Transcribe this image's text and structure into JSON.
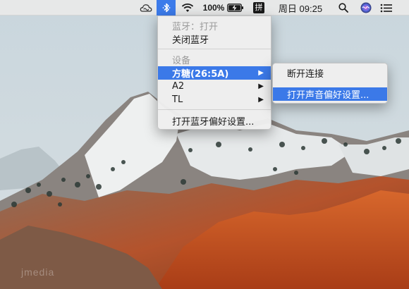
{
  "menubar": {
    "battery_percent": "100%",
    "input_method_glyph": "拼",
    "clock": "周日 09:25",
    "icons": [
      "creative-cloud-icon",
      "bluetooth-icon",
      "wifi-icon",
      "battery-charging-icon",
      "input-method-icon",
      "spotlight-search-icon",
      "siri-icon",
      "notification-center-icon"
    ]
  },
  "bluetooth_menu": {
    "status_label": "蓝牙：打开",
    "toggle_label": "关闭蓝牙",
    "devices_header": "设备",
    "devices": [
      {
        "label": "方糖(26:5A)",
        "has_submenu": true,
        "selected": true
      },
      {
        "label": "A2",
        "has_submenu": true,
        "selected": false
      },
      {
        "label": "TL",
        "has_submenu": true,
        "selected": false
      }
    ],
    "preferences_label": "打开蓝牙偏好设置...",
    "submenu_arrow": "▶"
  },
  "device_submenu": {
    "disconnect_label": "断开连接",
    "sound_prefs_label": "打开声音偏好设置..."
  },
  "watermark": "jmedia",
  "colors": {
    "selection": "#3b79e8",
    "menubar_active": "#3c7bea",
    "menu_background": "#eeeeee"
  }
}
